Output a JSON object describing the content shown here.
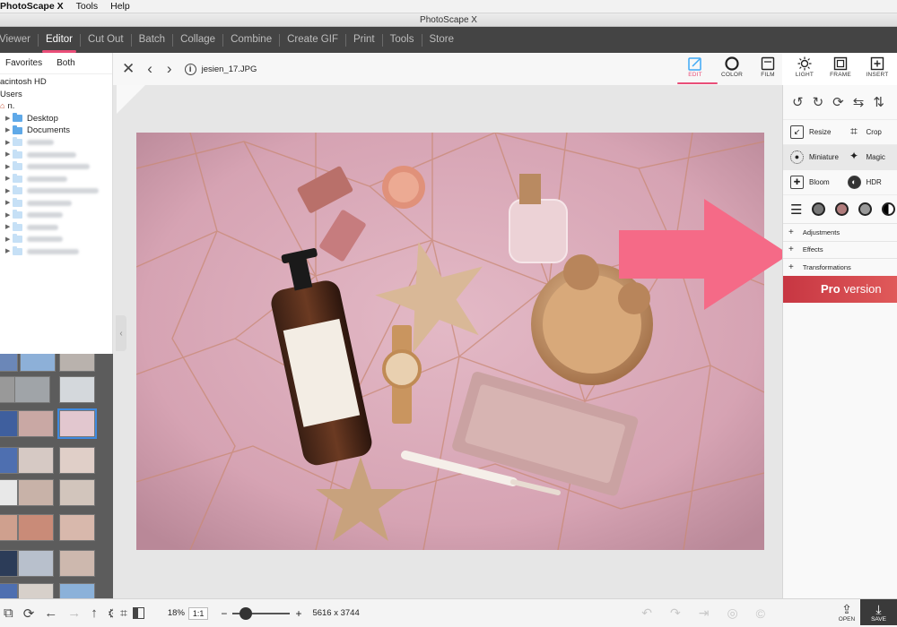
{
  "menubar": {
    "app_name": "PhotoScape X",
    "items": [
      "Tools",
      "Help"
    ]
  },
  "window_title": "PhotoScape X",
  "nav": {
    "tabs": [
      "Viewer",
      "Editor",
      "Cut Out",
      "Batch",
      "Collage",
      "Combine",
      "Create GIF",
      "Print",
      "Tools",
      "Store"
    ],
    "active": "Editor"
  },
  "browser": {
    "tabs": [
      "Favorites",
      "Both"
    ],
    "tree": [
      "acintosh HD",
      "Users",
      "n.",
      "Desktop",
      "Documents"
    ]
  },
  "editor": {
    "filename": "jesien_17.JPG",
    "info_glyph": "i",
    "zoom": "18%",
    "ratio_button": "1:1",
    "dimensions": "5616 x 3744",
    "minus": "−",
    "plus": "+"
  },
  "top_tools": [
    {
      "label": "EDIT",
      "icon": "edit-icon"
    },
    {
      "label": "COLOR",
      "icon": "color-icon"
    },
    {
      "label": "FILM",
      "icon": "film-icon"
    },
    {
      "label": "LIGHT",
      "icon": "light-icon"
    },
    {
      "label": "FRAME",
      "icon": "frame-icon"
    },
    {
      "label": "INSERT",
      "icon": "insert-icon"
    }
  ],
  "edit_panel": {
    "tools": [
      [
        "Resize",
        "Crop"
      ],
      [
        "Miniature",
        "Magic"
      ],
      [
        "Bloom",
        "HDR"
      ]
    ],
    "sections": [
      "Adjustments",
      "Effects",
      "Transformations"
    ],
    "pro_banner": {
      "bold": "Pro",
      "text": "version"
    }
  },
  "bottom_right": {
    "open_label": "OPEN",
    "save_label": "SAVE"
  },
  "colors": {
    "accent": "#e94e78",
    "arrow": "#f56a87",
    "nav_bg": "#444444",
    "photo_pink": "#d9a9b6"
  }
}
